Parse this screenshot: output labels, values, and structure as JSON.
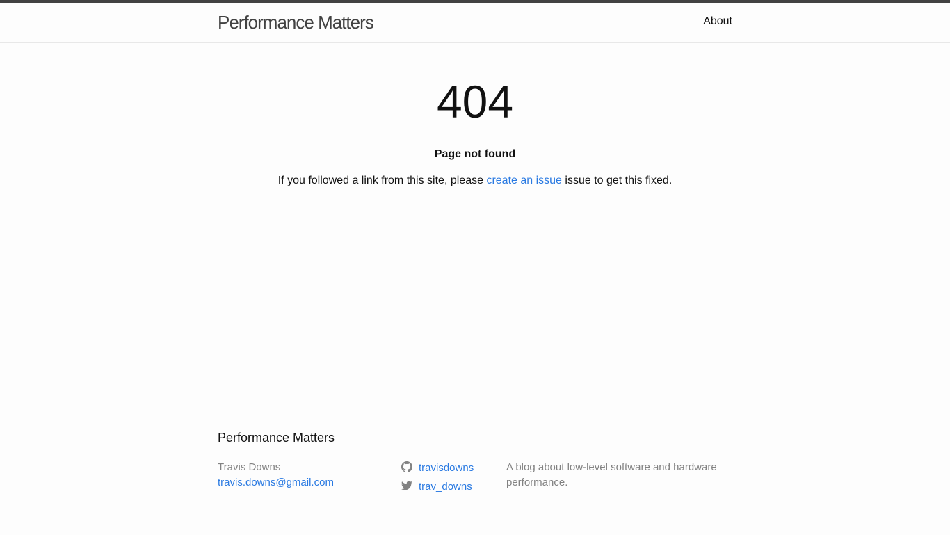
{
  "header": {
    "site_title": "Performance Matters",
    "nav": {
      "about": "About"
    }
  },
  "main": {
    "code": "404",
    "heading": "Page not found",
    "message_before": "If you followed a link from this site, please ",
    "link_text": "create an issue",
    "message_after": " issue to get this fixed."
  },
  "footer": {
    "title": "Performance Matters",
    "author": "Travis Downs",
    "email": "travis.downs@gmail.com",
    "github": "travisdowns",
    "twitter": "trav_downs",
    "description": "A blog about low-level software and hardware performance."
  },
  "colors": {
    "link": "#2a7ae2",
    "muted": "#828282",
    "topbar": "#424242"
  },
  "icons": {
    "github": "github-icon",
    "twitter": "twitter-icon"
  }
}
